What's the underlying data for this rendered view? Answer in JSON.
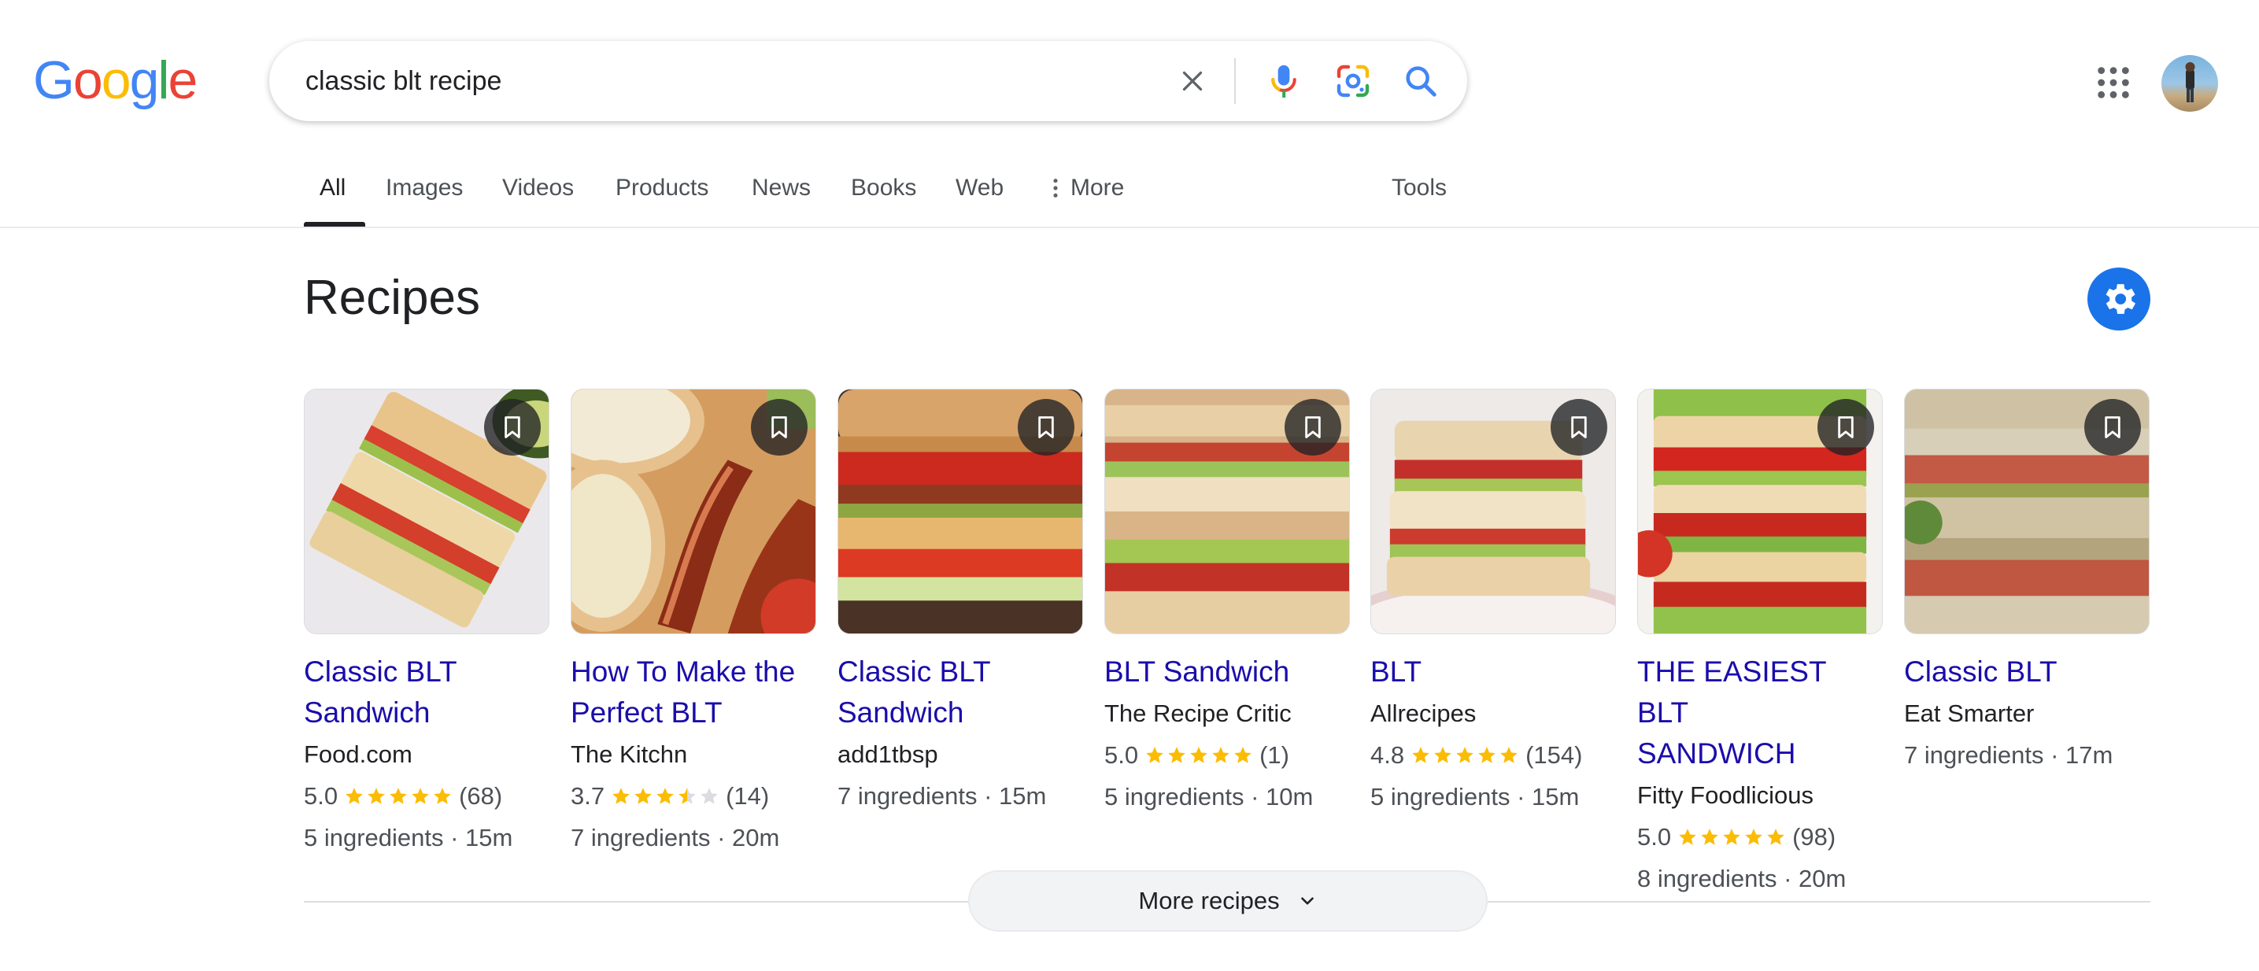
{
  "header": {
    "logo_text": "Google",
    "search": {
      "value": "classic blt recipe",
      "placeholder": ""
    }
  },
  "tabs": [
    {
      "label": "All",
      "active": true
    },
    {
      "label": "Images"
    },
    {
      "label": "Videos"
    },
    {
      "label": "Products"
    },
    {
      "label": "News"
    },
    {
      "label": "Books"
    },
    {
      "label": "Web"
    },
    {
      "label": "More"
    },
    {
      "label": "Tools"
    }
  ],
  "recipes": {
    "title": "Recipes",
    "cards": [
      {
        "title_line1": "Classic BLT",
        "title_line2": "Sandwich",
        "source": "Food.com",
        "rating": "5.0",
        "stars": 5,
        "reviews": "(68)",
        "meta": "5 ingredients · 15m"
      },
      {
        "title_line1": "How To Make the",
        "title_line2": "Perfect BLT",
        "source": "The Kitchn",
        "rating": "3.7",
        "stars": 3.5,
        "reviews": "(14)",
        "meta": "7 ingredients · 20m"
      },
      {
        "title_line1": "Classic BLT",
        "title_line2": "Sandwich",
        "source": "add1tbsp",
        "meta": "7 ingredients · 15m"
      },
      {
        "title_line1": "BLT Sandwich",
        "source": "The Recipe Critic",
        "rating": "5.0",
        "stars": 5,
        "reviews": "(1)",
        "meta": "5 ingredients · 10m"
      },
      {
        "title_line1": "BLT",
        "source": "Allrecipes",
        "rating": "4.8",
        "stars": 5,
        "reviews": "(154)",
        "meta": "5 ingredients · 15m"
      },
      {
        "title_line1": "THE EASIEST BLT",
        "title_line2": "SANDWICH",
        "source": "Fitty Foodlicious",
        "rating": "5.0",
        "stars": 5,
        "reviews": "(98)",
        "meta": "8 ingredients · 20m"
      },
      {
        "title_line1": "Classic BLT",
        "source": "Eat Smarter",
        "meta": "7 ingredients · 17m"
      }
    ],
    "more_label": "More recipes"
  },
  "colors": {
    "link": "#1a0dab",
    "star": "#fbbc04",
    "accent": "#1a73e8",
    "google_blue": "#4285f4",
    "google_red": "#ea4335",
    "google_yellow": "#fbbc05",
    "google_green": "#34a853"
  },
  "icons": [
    "clear-icon",
    "microphone-icon",
    "lens-icon",
    "search-icon",
    "apps-grid-icon",
    "more-dots-icon",
    "gear-icon",
    "bookmark-icon",
    "chevron-down-icon",
    "star-icon"
  ]
}
